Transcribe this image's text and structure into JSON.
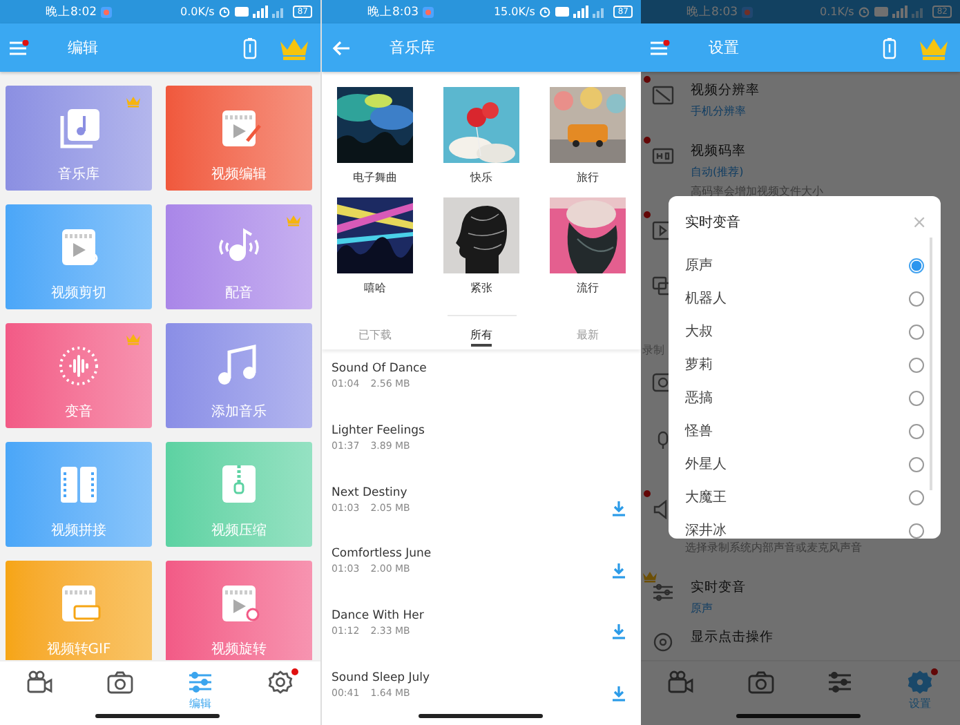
{
  "editor_screen": {
    "status_bar": {
      "time": "晚上8:02",
      "speed": "0.0K/s",
      "battery": "87"
    },
    "app_bar": {
      "title": "编辑",
      "menu_badge": true
    },
    "tiles": [
      {
        "label": "音乐库",
        "color": "#8b8fe2",
        "premium": true
      },
      {
        "label": "视频编辑",
        "color": "#f0583c",
        "premium": false
      },
      {
        "label": "视频剪切",
        "color": "#4aa6f8",
        "premium": false
      },
      {
        "label": "配音",
        "color": "#a986e8",
        "premium": true
      },
      {
        "label": "变音",
        "color": "#f25a86",
        "premium": true
      },
      {
        "label": "添加音乐",
        "color": "#8a8ee6",
        "premium": false
      },
      {
        "label": "视频拼接",
        "color": "#4aa6f8",
        "premium": false
      },
      {
        "label": "视频压缩",
        "color": "#5cd2a2",
        "premium": false
      },
      {
        "label": "视频转GIF",
        "color": "#f6a514",
        "premium": false
      },
      {
        "label": "视频旋转",
        "color": "#f25a86",
        "premium": false
      }
    ],
    "nav": [
      {
        "selected": false,
        "badge": false
      },
      {
        "selected": false,
        "badge": false
      },
      {
        "label": "编辑",
        "selected": true,
        "badge": false
      },
      {
        "selected": false,
        "badge": true
      }
    ]
  },
  "music_library_screen": {
    "status_bar": {
      "time": "晚上8:03",
      "speed": "15.0K/s",
      "battery": "87"
    },
    "app_bar": {
      "title": "音乐库"
    },
    "albums": [
      {
        "label": "电子舞曲"
      },
      {
        "label": "快乐"
      },
      {
        "label": "旅行"
      },
      {
        "label": "嘻哈"
      },
      {
        "label": "紧张"
      },
      {
        "label": "流行"
      }
    ],
    "tabs": [
      {
        "label": "已下载",
        "selected": false
      },
      {
        "label": "所有",
        "selected": true
      },
      {
        "label": "最新",
        "selected": false
      }
    ],
    "songs": [
      {
        "title": "Sound Of Dance",
        "duration": "01:04",
        "size": "2.56 MB",
        "downloadable": false
      },
      {
        "title": "Lighter Feelings",
        "duration": "01:37",
        "size": "3.89 MB",
        "downloadable": false
      },
      {
        "title": "Next Destiny",
        "duration": "01:03",
        "size": "2.05 MB",
        "downloadable": true
      },
      {
        "title": "Comfortless June",
        "duration": "01:03",
        "size": "2.00 MB",
        "downloadable": true
      },
      {
        "title": "Dance With Her",
        "duration": "01:12",
        "size": "2.33 MB",
        "downloadable": true
      },
      {
        "title": "Sound Sleep July",
        "duration": "00:41",
        "size": "1.64 MB",
        "downloadable": true
      }
    ]
  },
  "settings_screen": {
    "status_bar": {
      "time": "晚上8:03",
      "speed": "0.1K/s",
      "battery": "82"
    },
    "app_bar": {
      "title": "设置",
      "menu_badge": true
    },
    "settings": [
      {
        "kind": "row",
        "title": "视频分辨率",
        "value": "手机分辨率",
        "new": true,
        "premium": false
      },
      {
        "kind": "row",
        "title": "视频码率",
        "value": "自动(推荐)",
        "description": "高码率会增加视频文件大小",
        "new": true,
        "premium": false
      },
      {
        "kind": "row",
        "new": true,
        "premium": false
      },
      {
        "kind": "row",
        "new": false,
        "premium": false
      },
      {
        "kind": "section",
        "title": "录制"
      },
      {
        "kind": "row",
        "new": false,
        "premium": false
      },
      {
        "kind": "row",
        "new": false,
        "premium": false
      },
      {
        "kind": "row",
        "description": "选择录制系统内部声音或麦克风声音",
        "new": true,
        "premium": false
      },
      {
        "kind": "row",
        "title": "实时变音",
        "value": "原声",
        "new": false,
        "premium": true
      },
      {
        "kind": "row",
        "title": "显示点击操作",
        "new": false,
        "premium": false
      }
    ],
    "dialog": {
      "title": "实时变音",
      "close": "×",
      "options": [
        {
          "label": "原声",
          "selected": true
        },
        {
          "label": "机器人",
          "selected": false
        },
        {
          "label": "大叔",
          "selected": false
        },
        {
          "label": "萝莉",
          "selected": false
        },
        {
          "label": "恶搞",
          "selected": false
        },
        {
          "label": "怪兽",
          "selected": false
        },
        {
          "label": "外星人",
          "selected": false
        },
        {
          "label": "大魔王",
          "selected": false
        },
        {
          "label": "深井冰",
          "selected": false
        }
      ]
    },
    "nav": [
      {
        "selected": false,
        "badge": false
      },
      {
        "selected": false,
        "badge": false
      },
      {
        "selected": false,
        "badge": false
      },
      {
        "label": "设置",
        "selected": true,
        "badge": true
      }
    ]
  }
}
